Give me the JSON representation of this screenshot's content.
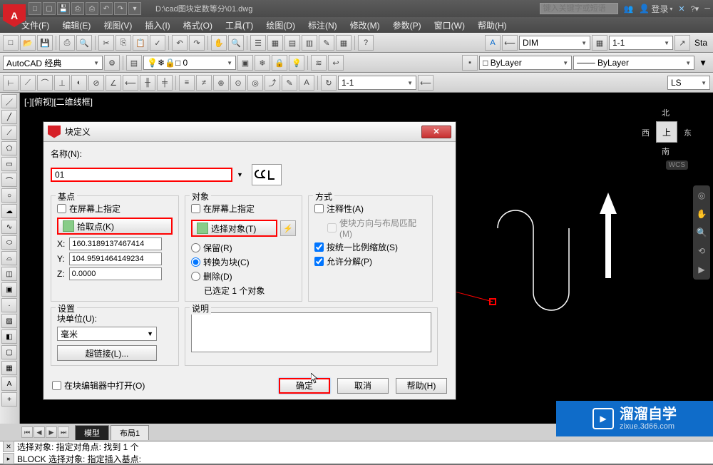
{
  "title_path": "D:\\cad图块定数等分\\01.dwg",
  "search_placeholder": "键入关键字或短语",
  "login": "登录",
  "menubar": [
    "文件(F)",
    "编辑(E)",
    "视图(V)",
    "插入(I)",
    "格式(O)",
    "工具(T)",
    "绘图(D)",
    "标注(N)",
    "修改(M)",
    "参数(P)",
    "窗口(W)",
    "帮助(H)"
  ],
  "workspace_combo": "AutoCAD 经典",
  "dim_combo": "DIM",
  "scale_combo": "1-1",
  "sta_label": "Sta",
  "layer_combo": "ByLayer",
  "layer_combo2": "ByLayer",
  "ls_combo": "LS",
  "zero": "0",
  "view_label": "[-][俯视][二维线框]",
  "viewcube": {
    "n": "北",
    "s": "南",
    "e": "东",
    "w": "西",
    "top": "上",
    "wcs": "WCS"
  },
  "dialog": {
    "title": "块定义",
    "name_label": "名称(N):",
    "name_value": "01",
    "basepoint": {
      "title": "基点",
      "onscreen": "在屏幕上指定",
      "pick": "拾取点(K)",
      "x_label": "X:",
      "x": "160.3189137467414",
      "y_label": "Y:",
      "y": "104.9591464149234",
      "z_label": "Z:",
      "z": "0.0000"
    },
    "objects": {
      "title": "对象",
      "onscreen": "在屏幕上指定",
      "select": "选择对象(T)",
      "retain": "保留(R)",
      "convert": "转换为块(C)",
      "delete": "删除(D)",
      "selected": "已选定 1 个对象"
    },
    "behavior": {
      "title": "方式",
      "annotative": "注释性(A)",
      "match_orient": "使块方向与布局匹配(M)",
      "scale_uniform": "按统一比例缩放(S)",
      "allow_explode": "允许分解(P)"
    },
    "settings": {
      "title": "设置",
      "unit_label": "块单位(U):",
      "unit": "毫米",
      "hyperlink": "超链接(L)..."
    },
    "description": {
      "title": "说明"
    },
    "open_in_editor": "在块编辑器中打开(O)",
    "ok": "确定",
    "cancel": "取消",
    "help": "帮助(H)"
  },
  "tabs": {
    "model": "模型",
    "layout1": "布局1"
  },
  "cmdline": {
    "history": "选择对象: 指定对角点: 找到 1 个",
    "prompt": "BLOCK 选择对象: 指定插入基点:"
  },
  "watermark": {
    "brand": "溜溜自学",
    "url": "zixue.3d66.com"
  }
}
